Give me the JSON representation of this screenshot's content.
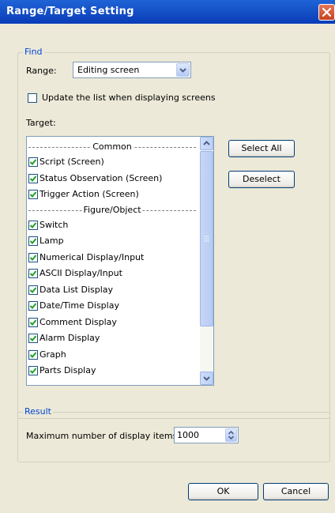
{
  "window": {
    "title": "Range/Target Setting"
  },
  "find": {
    "group_label": "Find",
    "range_label": "Range:",
    "range_value": "Editing screen",
    "update_checkbox_label": "Update the list when displaying screens",
    "update_checked": false,
    "target_label": "Target:",
    "items": [
      {
        "type": "header",
        "label": "Common"
      },
      {
        "type": "item",
        "label": "Script (Screen)",
        "checked": true
      },
      {
        "type": "item",
        "label": "Status Observation (Screen)",
        "checked": true
      },
      {
        "type": "item",
        "label": "Trigger Action (Screen)",
        "checked": true
      },
      {
        "type": "header",
        "label": "Figure/Object"
      },
      {
        "type": "item",
        "label": "Switch",
        "checked": true
      },
      {
        "type": "item",
        "label": "Lamp",
        "checked": true
      },
      {
        "type": "item",
        "label": "Numerical Display/Input",
        "checked": true
      },
      {
        "type": "item",
        "label": "ASCII Display/Input",
        "checked": true
      },
      {
        "type": "item",
        "label": "Data List Display",
        "checked": true
      },
      {
        "type": "item",
        "label": "Date/Time Display",
        "checked": true
      },
      {
        "type": "item",
        "label": "Comment Display",
        "checked": true
      },
      {
        "type": "item",
        "label": "Alarm Display",
        "checked": true
      },
      {
        "type": "item",
        "label": "Graph",
        "checked": true
      },
      {
        "type": "item",
        "label": "Parts Display",
        "checked": true
      }
    ],
    "select_all_label": "Select All",
    "deselect_label": "Deselect"
  },
  "result": {
    "group_label": "Result",
    "max_label": "Maximum number of display items:",
    "max_value": "1000"
  },
  "buttons": {
    "ok": "OK",
    "cancel": "Cancel"
  },
  "colors": {
    "title_bar": "#0a46c8",
    "dialog_bg": "#ece9d8",
    "group_label": "#0046d5",
    "checkbox_check": "#21a121"
  },
  "icons": {
    "close": "close-icon",
    "dropdown": "chevron-down-icon",
    "check": "checkmark-icon",
    "scroll_up": "arrow-up-icon",
    "scroll_down": "arrow-down-icon",
    "spin": "spin-updown-icon"
  }
}
